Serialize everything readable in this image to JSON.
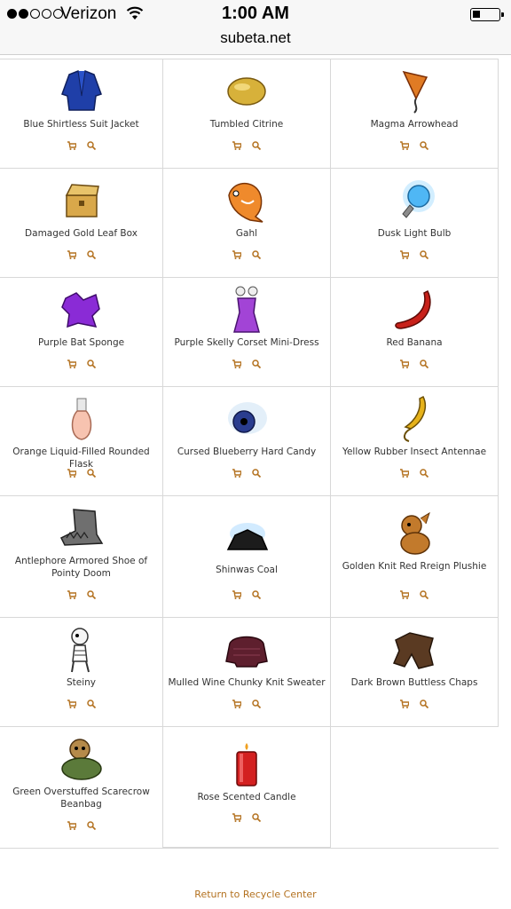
{
  "status_bar": {
    "carrier": "Verizon",
    "time": "1:00 AM",
    "signal_bars_filled": 2,
    "signal_bars_total": 5
  },
  "browser": {
    "url": "subeta.net"
  },
  "colors": {
    "accent": "#b3711f"
  },
  "items": [
    {
      "name": "Blue Shirtless Suit Jacket",
      "icon": "blue-jacket-icon"
    },
    {
      "name": "Tumbled Citrine",
      "icon": "citrine-icon"
    },
    {
      "name": "Magma Arrowhead",
      "icon": "arrowhead-icon"
    },
    {
      "name": "Damaged Gold Leaf Box",
      "icon": "gold-box-icon"
    },
    {
      "name": "Gahl",
      "icon": "fish-icon"
    },
    {
      "name": "Dusk Light Bulb",
      "icon": "light-bulb-icon"
    },
    {
      "name": "Purple Bat Sponge",
      "icon": "purple-sponge-icon"
    },
    {
      "name": "Purple Skelly Corset Mini-Dress",
      "icon": "dress-icon"
    },
    {
      "name": "Red Banana",
      "icon": "banana-icon"
    },
    {
      "name": "Orange Liquid-Filled Rounded Flask",
      "icon": "flask-icon"
    },
    {
      "name": "Cursed Blueberry Hard Candy",
      "icon": "candy-icon"
    },
    {
      "name": "Yellow Rubber Insect Antennae",
      "icon": "antennae-icon"
    },
    {
      "name": "Antlephore Armored Shoe of Pointy Doom",
      "icon": "armored-shoe-icon"
    },
    {
      "name": "Shinwas Coal",
      "icon": "coal-icon"
    },
    {
      "name": "Golden Knit Red Rreign Plushie",
      "icon": "plushie-icon"
    },
    {
      "name": "Steiny",
      "icon": "skeleton-pet-icon"
    },
    {
      "name": "Mulled Wine Chunky Knit Sweater",
      "icon": "sweater-icon"
    },
    {
      "name": "Dark Brown Buttless Chaps",
      "icon": "chaps-icon"
    },
    {
      "name": "Green Overstuffed Scarecrow Beanbag",
      "icon": "scarecrow-beanbag-icon"
    },
    {
      "name": "Rose Scented Candle",
      "icon": "candle-icon"
    }
  ],
  "footer": {
    "return_link": "Return to Recycle Center"
  }
}
